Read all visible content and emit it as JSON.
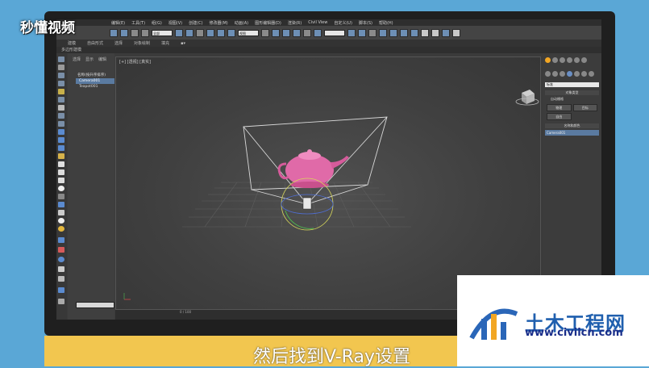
{
  "overlay": {
    "logo_text": "秒懂视频",
    "caption": "然后找到V-Ray设置",
    "watermark_title": "土木工程网",
    "watermark_url": "www.civilcn.com"
  },
  "app": {
    "menu_items": [
      "编辑(E)",
      "工具(T)",
      "组(G)",
      "视图(V)",
      "创建(C)",
      "修改器(M)",
      "动画(A)",
      "图形编辑器(D)",
      "渲染(R)",
      "Civil View",
      "自定义(U)",
      "脚本(S)",
      "帮助(H)"
    ],
    "selection_dropdown": "全部",
    "view_dropdown": "视图",
    "ribbon_tabs": [
      "建模",
      "自由形式",
      "选择",
      "对象绘制",
      "填充"
    ],
    "ribbon_sub": "多边形建模",
    "scene_tabs": [
      "选择",
      "显示",
      "编辑"
    ],
    "scene_header": "名称(按升序排序)",
    "scene_items": [
      "Camera001",
      "Teapot001"
    ],
    "viewport_label": "[+] [透视] [真实]",
    "timeline_text": "0 / 100",
    "cmd_dropdown": "标准",
    "cmd_section1": "对象类型",
    "cmd_autogrid": "自动栅格",
    "cmd_buttons": [
      "物理",
      "目标",
      "自由"
    ],
    "cmd_section2": "名称和颜色",
    "cmd_name_field": "Camera001"
  }
}
